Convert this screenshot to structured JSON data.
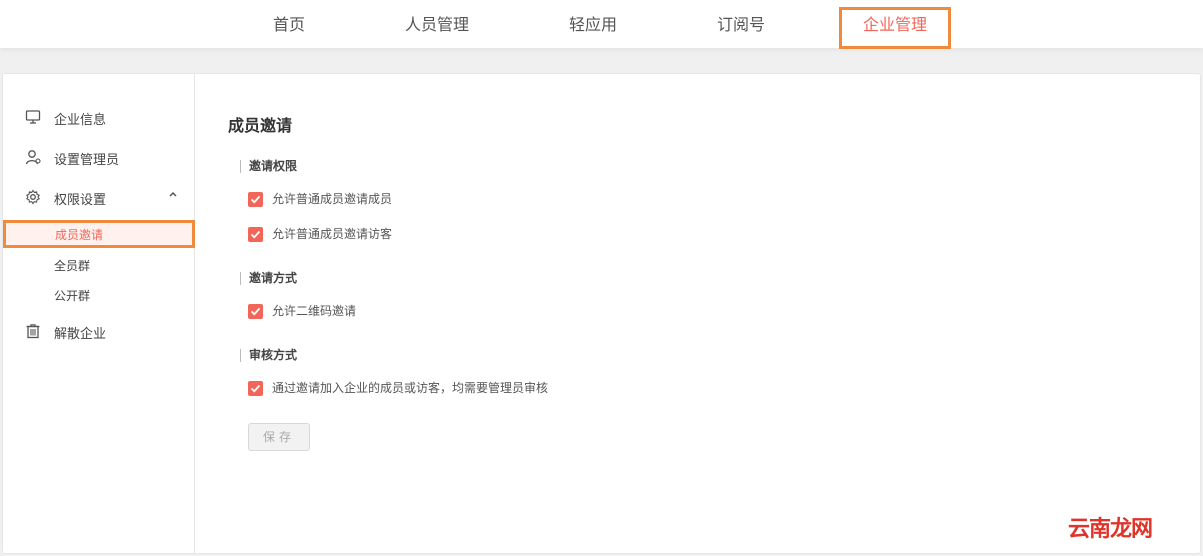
{
  "topnav": {
    "items": [
      "首页",
      "人员管理",
      "轻应用",
      "订阅号"
    ],
    "active": "企业管理"
  },
  "sidebar": {
    "items": [
      {
        "label": "企业信息",
        "icon": "monitor-icon"
      },
      {
        "label": "设置管理员",
        "icon": "admin-user-icon"
      },
      {
        "label": "权限设置",
        "icon": "gear-icon"
      },
      {
        "label": "解散企业",
        "icon": "trash-icon"
      }
    ],
    "subitems": [
      "成员邀请",
      "全员群",
      "公开群"
    ]
  },
  "main": {
    "title": "成员邀请",
    "sections": [
      {
        "title": "邀请权限",
        "options": [
          "允许普通成员邀请成员",
          "允许普通成员邀请访客"
        ]
      },
      {
        "title": "邀请方式",
        "options": [
          "允许二维码邀请"
        ]
      },
      {
        "title": "审核方式",
        "options": [
          "通过邀请加入企业的成员或访客，均需要管理员审核"
        ]
      }
    ],
    "save_label": "保存"
  },
  "watermark": "云南龙网",
  "colors": {
    "accent": "#f2665a",
    "highlight_border": "#f08a3c"
  }
}
